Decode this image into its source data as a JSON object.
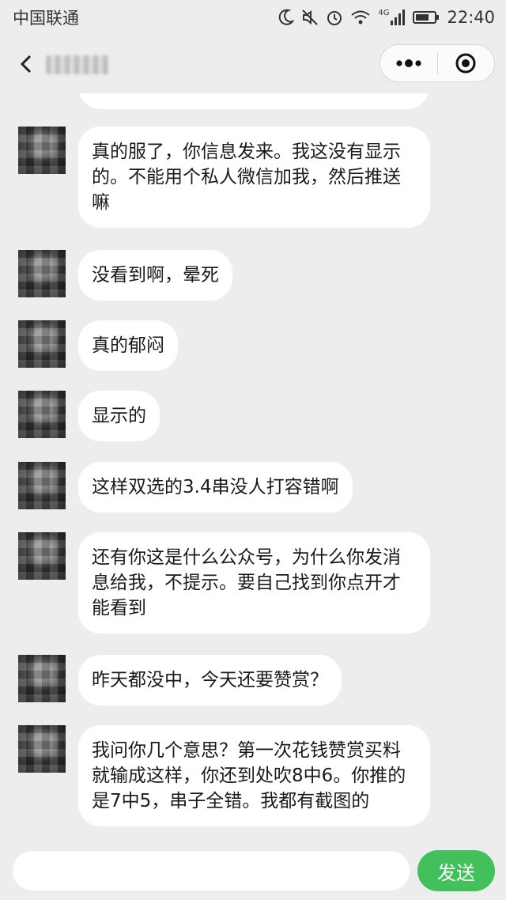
{
  "status_bar": {
    "carrier": "中国联通",
    "network": "4G",
    "time": "22:40",
    "icons": [
      "moon-icon",
      "mute-icon",
      "alarm-icon",
      "wifi-icon",
      "signal-icon",
      "battery-icon"
    ]
  },
  "nav": {
    "title": "",
    "back_icon": "back-arrow-icon",
    "menu_icon": "more-dots-icon",
    "close_icon": "target-close-icon"
  },
  "messages": [
    {
      "text": "真的服了，你信息发来。我这没有显示的。不能用个私人微信加我，然后推送嘛"
    },
    {
      "text": "没看到啊，晕死"
    },
    {
      "text": "真的郁闷"
    },
    {
      "text": "显示的"
    },
    {
      "text": "这样双选的3.4串没人打容错啊"
    },
    {
      "text": "还有你这是什么公众号，为什么你发消息给我，不提示。要自己找到你点开才能看到"
    },
    {
      "text": "昨天都没中，今天还要赞赏？"
    },
    {
      "text": "我问你几个意思？第一次花钱赞赏买料就输成这样，你还到处吹8中6。你推的是7中5，串子全错。我都有截图的"
    }
  ],
  "input": {
    "placeholder": "",
    "value": ""
  },
  "send_label": "发送",
  "colors": {
    "background": "#ededed",
    "bubble": "#ffffff",
    "send_button": "#42c05c"
  }
}
